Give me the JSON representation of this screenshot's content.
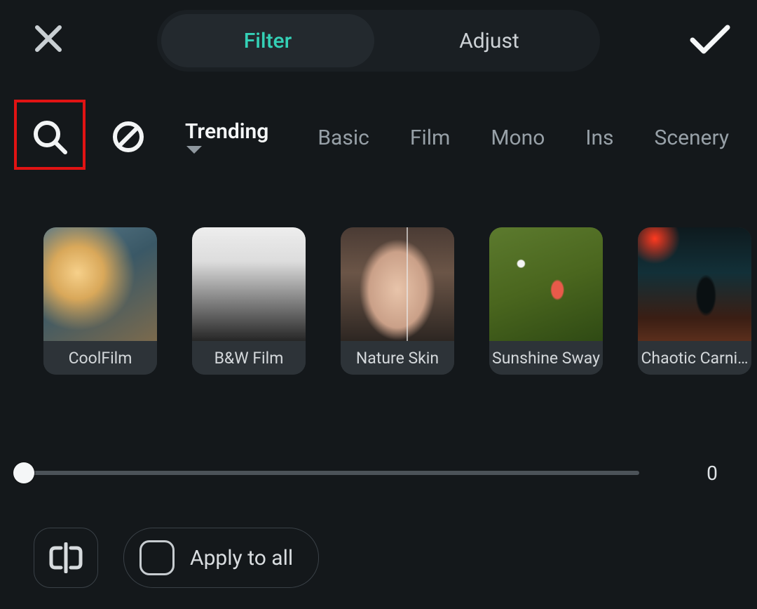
{
  "modes": {
    "filter": "Filter",
    "adjust": "Adjust",
    "active": "filter"
  },
  "categories": [
    {
      "id": "trending",
      "label": "Trending",
      "active": true,
      "dropdown": true
    },
    {
      "id": "basic",
      "label": "Basic"
    },
    {
      "id": "film",
      "label": "Film"
    },
    {
      "id": "mono",
      "label": "Mono"
    },
    {
      "id": "ins",
      "label": "Ins"
    },
    {
      "id": "scenery",
      "label": "Scenery"
    }
  ],
  "filters": [
    {
      "id": "coolfilm",
      "label": "CoolFilm"
    },
    {
      "id": "bw_film",
      "label": "B&W Film"
    },
    {
      "id": "nature_skin",
      "label": "Nature Skin"
    },
    {
      "id": "sunshine_sway",
      "label": "Sunshine Sway"
    },
    {
      "id": "chaotic_carni",
      "label": "Chaotic Carni…"
    }
  ],
  "slider": {
    "value": 0,
    "display": "0"
  },
  "apply_all_label": "Apply to all",
  "icons": {
    "close": "close-icon",
    "confirm": "check-icon",
    "search": "search-icon",
    "none": "none-filter-icon",
    "compare": "compare-split-icon",
    "chevron": "chevron-down-icon"
  },
  "highlight": {
    "target": "search-button"
  }
}
